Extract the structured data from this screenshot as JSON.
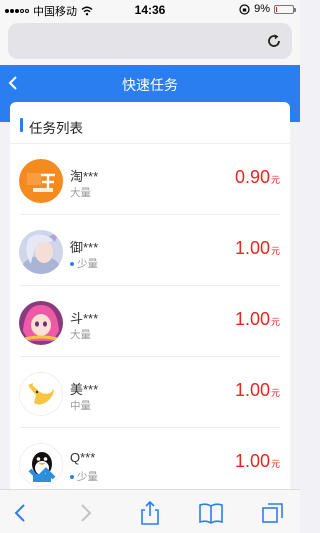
{
  "status": {
    "carrier": "中国移动",
    "time": "14:36",
    "battery": "9%",
    "battery_level": 0.09
  },
  "header": {
    "title": "快速任务"
  },
  "section": {
    "title": "任务列表"
  },
  "tasks": [
    {
      "name": "淘***",
      "quantity": "大量",
      "dot": false,
      "price": "0.90",
      "unit": "元",
      "avatar": "taobao-avatar"
    },
    {
      "name": "御***",
      "quantity": "少量",
      "dot": true,
      "price": "1.00",
      "unit": "元",
      "avatar": "game-girl-avatar"
    },
    {
      "name": "斗***",
      "quantity": "大量",
      "dot": false,
      "price": "1.00",
      "unit": "元",
      "avatar": "pink-hair-avatar"
    },
    {
      "name": "美***",
      "quantity": "中量",
      "dot": false,
      "price": "1.00",
      "unit": "元",
      "avatar": "kangaroo-avatar"
    },
    {
      "name": "Q***",
      "quantity": "少量",
      "dot": true,
      "price": "1.00",
      "unit": "元",
      "avatar": "qq-penguin-avatar"
    }
  ],
  "colors": {
    "accent": "#2b7ef0",
    "price": "#e6261f"
  }
}
